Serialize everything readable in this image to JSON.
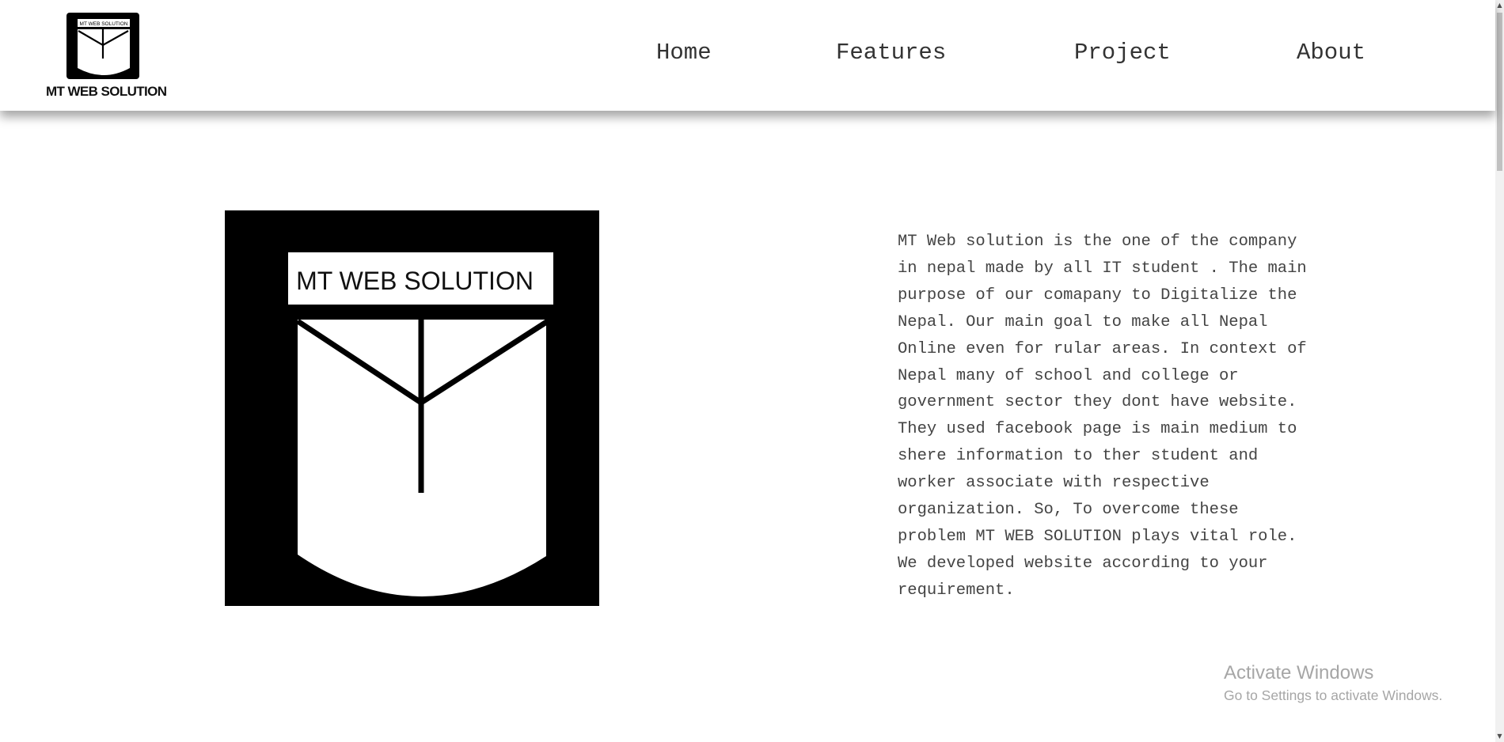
{
  "header": {
    "brand": {
      "logo_icon": "mt-web-solution-shield-logo",
      "logo_text": "MT WEB SOLUTION",
      "name": "MT WEB SOLUTION"
    },
    "nav": [
      {
        "label": "Home"
      },
      {
        "label": "Features"
      },
      {
        "label": "Project"
      },
      {
        "label": "About"
      }
    ]
  },
  "main": {
    "logo_icon": "mt-web-solution-shield-logo",
    "logo_text": "MT WEB SOLUTION",
    "about_text": "MT Web solution is the one of the company\nin nepal made by all IT student . The main\npurpose of our comapany to Digitalize the\nNepal. Our main goal to make all Nepal\nOnline even for rular areas. In context of\nNepal many of school and college or\ngovernment sector they dont have website.\nThey used facebook page is main medium to\nshere information to ther student and\nworker associate with respective\norganization. So, To overcome these\nproblem MT WEB SOLUTION plays vital role.\nWe developed website according to your\nrequirement."
  },
  "watermark": {
    "title": "Activate Windows",
    "subtitle": "Go to Settings to activate Windows."
  },
  "colors": {
    "logo_black": "#000000",
    "logo_white": "#ffffff",
    "nav_text": "#333333",
    "body_text": "#444444",
    "watermark_text": "#a6a6a6"
  },
  "icons": {
    "scroll_up": "scroll-up-arrow-icon",
    "scroll_down": "scroll-down-arrow-icon"
  }
}
